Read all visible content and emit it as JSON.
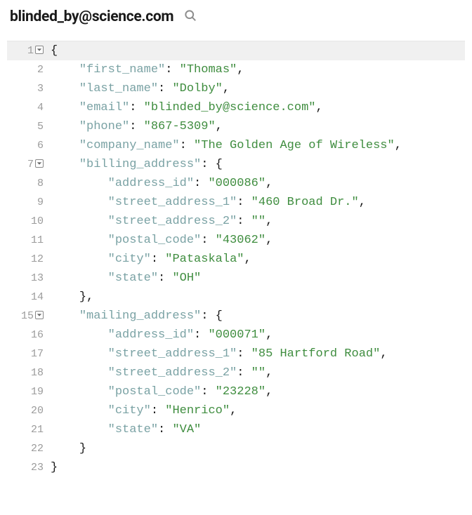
{
  "header": {
    "title": "blinded_by@science.com",
    "search_icon": "search-icon"
  },
  "code": {
    "lines": [
      {
        "n": "1",
        "fold": "open",
        "indent": 0,
        "segs": [
          {
            "t": "{",
            "c": "p"
          }
        ]
      },
      {
        "n": "2",
        "fold": null,
        "indent": 1,
        "segs": [
          {
            "t": "\"first_name\"",
            "c": "k"
          },
          {
            "t": ": ",
            "c": "p"
          },
          {
            "t": "\"Thomas\"",
            "c": "s"
          },
          {
            "t": ",",
            "c": "p"
          }
        ]
      },
      {
        "n": "3",
        "fold": null,
        "indent": 1,
        "segs": [
          {
            "t": "\"last_name\"",
            "c": "k"
          },
          {
            "t": ": ",
            "c": "p"
          },
          {
            "t": "\"Dolby\"",
            "c": "s"
          },
          {
            "t": ",",
            "c": "p"
          }
        ]
      },
      {
        "n": "4",
        "fold": null,
        "indent": 1,
        "segs": [
          {
            "t": "\"email\"",
            "c": "k"
          },
          {
            "t": ": ",
            "c": "p"
          },
          {
            "t": "\"blinded_by@science.com\"",
            "c": "s"
          },
          {
            "t": ",",
            "c": "p"
          }
        ]
      },
      {
        "n": "5",
        "fold": null,
        "indent": 1,
        "segs": [
          {
            "t": "\"phone\"",
            "c": "k"
          },
          {
            "t": ": ",
            "c": "p"
          },
          {
            "t": "\"867-5309\"",
            "c": "s"
          },
          {
            "t": ",",
            "c": "p"
          }
        ]
      },
      {
        "n": "6",
        "fold": null,
        "indent": 1,
        "segs": [
          {
            "t": "\"company_name\"",
            "c": "k"
          },
          {
            "t": ": ",
            "c": "p"
          },
          {
            "t": "\"The Golden Age of Wireless\"",
            "c": "s"
          },
          {
            "t": ",",
            "c": "p"
          }
        ]
      },
      {
        "n": "7",
        "fold": "open",
        "indent": 1,
        "segs": [
          {
            "t": "\"billing_address\"",
            "c": "k"
          },
          {
            "t": ": {",
            "c": "p"
          }
        ]
      },
      {
        "n": "8",
        "fold": null,
        "indent": 2,
        "segs": [
          {
            "t": "\"address_id\"",
            "c": "k"
          },
          {
            "t": ": ",
            "c": "p"
          },
          {
            "t": "\"000086\"",
            "c": "s"
          },
          {
            "t": ",",
            "c": "p"
          }
        ]
      },
      {
        "n": "9",
        "fold": null,
        "indent": 2,
        "segs": [
          {
            "t": "\"street_address_1\"",
            "c": "k"
          },
          {
            "t": ": ",
            "c": "p"
          },
          {
            "t": "\"460 Broad Dr.\"",
            "c": "s"
          },
          {
            "t": ",",
            "c": "p"
          }
        ]
      },
      {
        "n": "10",
        "fold": null,
        "indent": 2,
        "segs": [
          {
            "t": "\"street_address_2\"",
            "c": "k"
          },
          {
            "t": ": ",
            "c": "p"
          },
          {
            "t": "\"\"",
            "c": "s"
          },
          {
            "t": ",",
            "c": "p"
          }
        ]
      },
      {
        "n": "11",
        "fold": null,
        "indent": 2,
        "segs": [
          {
            "t": "\"postal_code\"",
            "c": "k"
          },
          {
            "t": ": ",
            "c": "p"
          },
          {
            "t": "\"43062\"",
            "c": "s"
          },
          {
            "t": ",",
            "c": "p"
          }
        ]
      },
      {
        "n": "12",
        "fold": null,
        "indent": 2,
        "segs": [
          {
            "t": "\"city\"",
            "c": "k"
          },
          {
            "t": ": ",
            "c": "p"
          },
          {
            "t": "\"Pataskala\"",
            "c": "s"
          },
          {
            "t": ",",
            "c": "p"
          }
        ]
      },
      {
        "n": "13",
        "fold": null,
        "indent": 2,
        "segs": [
          {
            "t": "\"state\"",
            "c": "k"
          },
          {
            "t": ": ",
            "c": "p"
          },
          {
            "t": "\"OH\"",
            "c": "s"
          }
        ]
      },
      {
        "n": "14",
        "fold": null,
        "indent": 1,
        "segs": [
          {
            "t": "},",
            "c": "p"
          }
        ]
      },
      {
        "n": "15",
        "fold": "open",
        "indent": 1,
        "segs": [
          {
            "t": "\"mailing_address\"",
            "c": "k"
          },
          {
            "t": ": {",
            "c": "p"
          }
        ]
      },
      {
        "n": "16",
        "fold": null,
        "indent": 2,
        "segs": [
          {
            "t": "\"address_id\"",
            "c": "k"
          },
          {
            "t": ": ",
            "c": "p"
          },
          {
            "t": "\"000071\"",
            "c": "s"
          },
          {
            "t": ",",
            "c": "p"
          }
        ]
      },
      {
        "n": "17",
        "fold": null,
        "indent": 2,
        "segs": [
          {
            "t": "\"street_address_1\"",
            "c": "k"
          },
          {
            "t": ": ",
            "c": "p"
          },
          {
            "t": "\"85 Hartford Road\"",
            "c": "s"
          },
          {
            "t": ",",
            "c": "p"
          }
        ]
      },
      {
        "n": "18",
        "fold": null,
        "indent": 2,
        "segs": [
          {
            "t": "\"street_address_2\"",
            "c": "k"
          },
          {
            "t": ": ",
            "c": "p"
          },
          {
            "t": "\"\"",
            "c": "s"
          },
          {
            "t": ",",
            "c": "p"
          }
        ]
      },
      {
        "n": "19",
        "fold": null,
        "indent": 2,
        "segs": [
          {
            "t": "\"postal_code\"",
            "c": "k"
          },
          {
            "t": ": ",
            "c": "p"
          },
          {
            "t": "\"23228\"",
            "c": "s"
          },
          {
            "t": ",",
            "c": "p"
          }
        ]
      },
      {
        "n": "20",
        "fold": null,
        "indent": 2,
        "segs": [
          {
            "t": "\"city\"",
            "c": "k"
          },
          {
            "t": ": ",
            "c": "p"
          },
          {
            "t": "\"Henrico\"",
            "c": "s"
          },
          {
            "t": ",",
            "c": "p"
          }
        ]
      },
      {
        "n": "21",
        "fold": null,
        "indent": 2,
        "segs": [
          {
            "t": "\"state\"",
            "c": "k"
          },
          {
            "t": ": ",
            "c": "p"
          },
          {
            "t": "\"VA\"",
            "c": "s"
          }
        ]
      },
      {
        "n": "22",
        "fold": null,
        "indent": 1,
        "segs": [
          {
            "t": "}",
            "c": "p"
          }
        ]
      },
      {
        "n": "23",
        "fold": null,
        "indent": 0,
        "segs": [
          {
            "t": "}",
            "c": "p"
          }
        ]
      }
    ]
  }
}
